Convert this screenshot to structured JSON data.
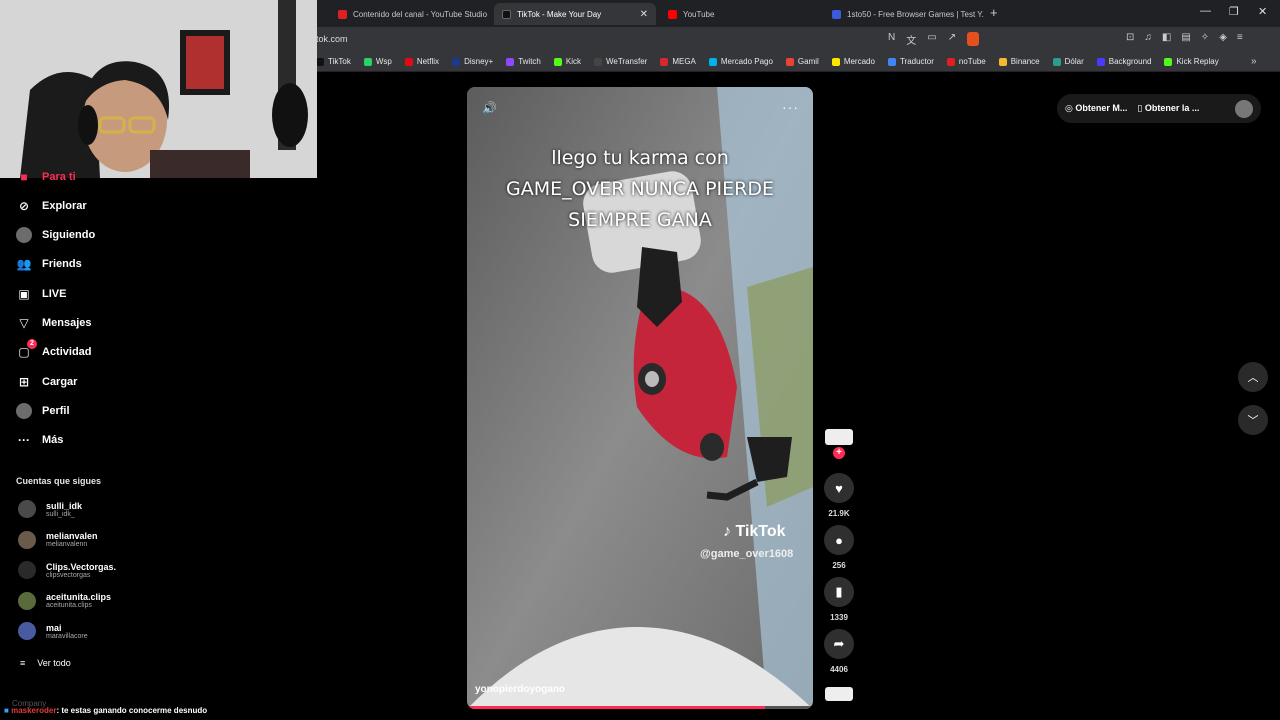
{
  "browser": {
    "tabs": [
      {
        "label": "Contenido del canal - YouTube Studio",
        "color": "#e02020",
        "active": false
      },
      {
        "label": "TikTok - Make Your Day",
        "color": "#111111",
        "active": true
      },
      {
        "label": "YouTube",
        "color": "#ff0000",
        "active": false
      },
      {
        "label": "1sto50 - Free Browser Games | Test Y...",
        "color": "#3b5bdb",
        "active": false
      }
    ],
    "url": "tok.com",
    "bookmarks": [
      {
        "label": "TikTok",
        "color": "#111111"
      },
      {
        "label": "Wsp",
        "color": "#25d366"
      },
      {
        "label": "Netflix",
        "color": "#e50914"
      },
      {
        "label": "Disney+",
        "color": "#1a3a8a"
      },
      {
        "label": "Twitch",
        "color": "#9146ff"
      },
      {
        "label": "Kick",
        "color": "#53fc18"
      },
      {
        "label": "WeTransfer",
        "color": "#444444"
      },
      {
        "label": "MEGA",
        "color": "#d9272e"
      },
      {
        "label": "Mercado Pago",
        "color": "#00b1ea"
      },
      {
        "label": "Gamil",
        "color": "#ea4335"
      },
      {
        "label": "Mercado",
        "color": "#ffe600"
      },
      {
        "label": "Traductor",
        "color": "#4285f4"
      },
      {
        "label": "noTube",
        "color": "#e02020"
      },
      {
        "label": "Binance",
        "color": "#f3ba2f"
      },
      {
        "label": "Dólar",
        "color": "#2a9d8f"
      },
      {
        "label": "Background",
        "color": "#4a3aff"
      },
      {
        "label": "Kick Replay",
        "color": "#53fc18"
      }
    ]
  },
  "sidebar": {
    "partial_top": "Para ti",
    "items": [
      {
        "label": "Explorar",
        "icon": "compass-icon",
        "glyph": "⊘"
      },
      {
        "label": "Siguiendo",
        "icon": "following-avatar-icon",
        "glyph": ""
      },
      {
        "label": "Friends",
        "icon": "friends-icon",
        "glyph": "👥"
      },
      {
        "label": "LIVE",
        "icon": "live-icon",
        "glyph": "▣"
      },
      {
        "label": "Mensajes",
        "icon": "messages-icon",
        "glyph": "▽"
      },
      {
        "label": "Actividad",
        "icon": "activity-icon",
        "glyph": "▢",
        "badge": "2"
      },
      {
        "label": "Cargar",
        "icon": "upload-icon",
        "glyph": "⊞"
      },
      {
        "label": "Perfil",
        "icon": "profile-avatar-icon",
        "glyph": ""
      },
      {
        "label": "Más",
        "icon": "more-icon",
        "glyph": "···"
      }
    ],
    "following_title": "Cuentas que sigues",
    "following": [
      {
        "name": "sulli_idk",
        "handle": "sulli_idk_"
      },
      {
        "name": "melianvalen",
        "handle": "melianvalenn"
      },
      {
        "name": "Clips.Vectorgas.",
        "handle": "clipsvectorgas"
      },
      {
        "name": "aceitunita.clips",
        "handle": "aceitunita.clips"
      },
      {
        "name": "mai",
        "handle": "maravillacore"
      }
    ],
    "see_all": "Ver todo"
  },
  "video": {
    "caption_lines": [
      "llego tu karma con",
      "GAME_OVER NUNCA PIERDE",
      "SIEMPRE GANA"
    ],
    "watermark": "TikTok",
    "watermark_handle": "@game_over1608",
    "author": "yonopierdoyogano",
    "progress_fraction": 0.86
  },
  "actions": {
    "likes": "21.9K",
    "comments": "256",
    "saves": "1339",
    "shares": "4406"
  },
  "top_right": {
    "pill1": "Obtener M...",
    "pill2": "Obtener la ..."
  },
  "chat": {
    "user": "maskeroder",
    "message": ": te estas ganando conocerme desnudo",
    "company": "Company"
  },
  "colors": {
    "accent": "#fe2c55",
    "background": "#000000"
  }
}
